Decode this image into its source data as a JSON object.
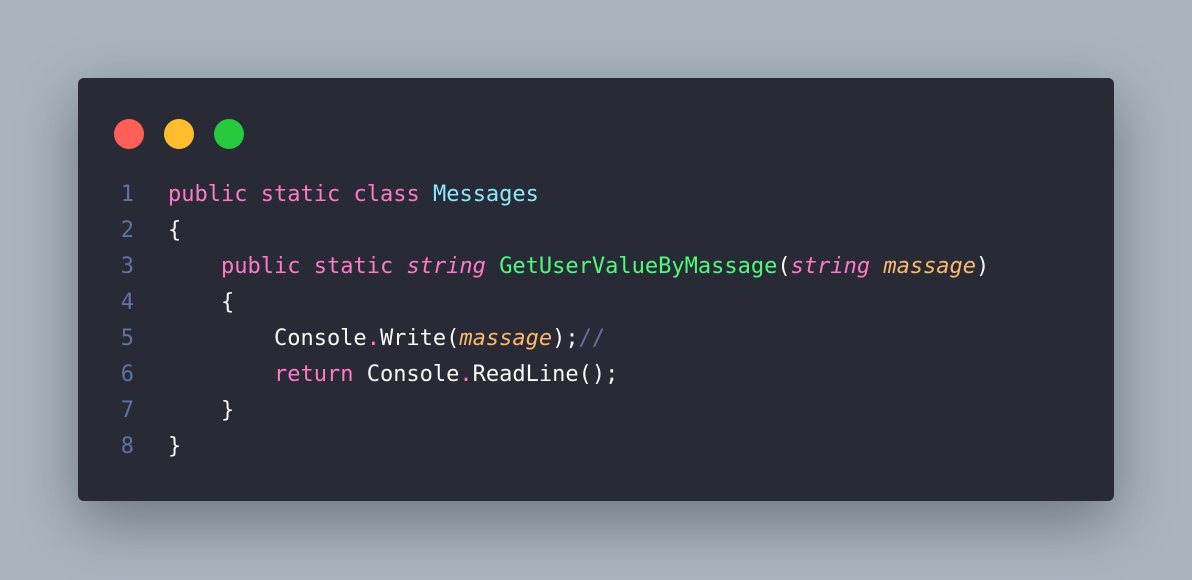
{
  "window": {
    "buttons": [
      {
        "name": "close",
        "color": "#ff5f56"
      },
      {
        "name": "minimize",
        "color": "#ffbd2e"
      },
      {
        "name": "maximize",
        "color": "#27c93f"
      }
    ]
  },
  "code": {
    "lines": [
      {
        "num": "1",
        "tokens": {
          "t0": "public",
          "t1": " ",
          "t2": "static",
          "t3": " ",
          "t4": "class",
          "t5": " ",
          "t6": "Messages"
        }
      },
      {
        "num": "2",
        "tokens": {
          "t0": "{"
        }
      },
      {
        "num": "3",
        "tokens": {
          "t0": "    ",
          "t1": "public",
          "t2": " ",
          "t3": "static",
          "t4": " ",
          "t5": "string",
          "t6": " ",
          "t7": "GetUserValueByMassage",
          "t8": "(",
          "t9": "string",
          "t10": " ",
          "t11": "massage",
          "t12": ")"
        }
      },
      {
        "num": "4",
        "tokens": {
          "t0": "    {"
        }
      },
      {
        "num": "5",
        "tokens": {
          "t0": "        Console",
          "t1": ".",
          "t2": "Write(",
          "t3": "massage",
          "t4": ");",
          "t5": "//"
        }
      },
      {
        "num": "6",
        "tokens": {
          "t0": "        ",
          "t1": "return",
          "t2": " Console",
          "t3": ".",
          "t4": "ReadLine();"
        }
      },
      {
        "num": "7",
        "tokens": {
          "t0": "    }"
        }
      },
      {
        "num": "8",
        "tokens": {
          "t0": "}"
        }
      }
    ]
  }
}
